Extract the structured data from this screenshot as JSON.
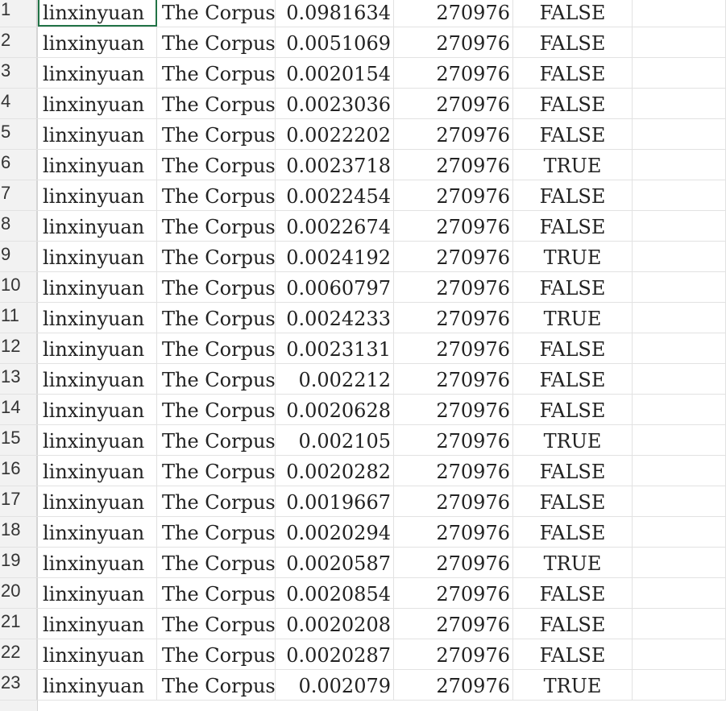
{
  "sheet": {
    "rows": [
      {
        "num": "1",
        "a": "linxinyuan",
        "b": "The Corpus",
        "c": "0.0981634",
        "d": "270976",
        "e": "FALSE"
      },
      {
        "num": "2",
        "a": "linxinyuan",
        "b": "The Corpus",
        "c": "0.0051069",
        "d": "270976",
        "e": "FALSE"
      },
      {
        "num": "3",
        "a": "linxinyuan",
        "b": "The Corpus",
        "c": "0.0020154",
        "d": "270976",
        "e": "FALSE"
      },
      {
        "num": "4",
        "a": "linxinyuan",
        "b": "The Corpus",
        "c": "0.0023036",
        "d": "270976",
        "e": "FALSE"
      },
      {
        "num": "5",
        "a": "linxinyuan",
        "b": "The Corpus",
        "c": "0.0022202",
        "d": "270976",
        "e": "FALSE"
      },
      {
        "num": "6",
        "a": "linxinyuan",
        "b": "The Corpus",
        "c": "0.0023718",
        "d": "270976",
        "e": "TRUE"
      },
      {
        "num": "7",
        "a": "linxinyuan",
        "b": "The Corpus",
        "c": "0.0022454",
        "d": "270976",
        "e": "FALSE"
      },
      {
        "num": "8",
        "a": "linxinyuan",
        "b": "The Corpus",
        "c": "0.0022674",
        "d": "270976",
        "e": "FALSE"
      },
      {
        "num": "9",
        "a": "linxinyuan",
        "b": "The Corpus",
        "c": "0.0024192",
        "d": "270976",
        "e": "TRUE"
      },
      {
        "num": "10",
        "a": "linxinyuan",
        "b": "The Corpus",
        "c": "0.0060797",
        "d": "270976",
        "e": "FALSE"
      },
      {
        "num": "11",
        "a": "linxinyuan",
        "b": "The Corpus",
        "c": "0.0024233",
        "d": "270976",
        "e": "TRUE"
      },
      {
        "num": "12",
        "a": "linxinyuan",
        "b": "The Corpus",
        "c": "0.0023131",
        "d": "270976",
        "e": "FALSE"
      },
      {
        "num": "13",
        "a": "linxinyuan",
        "b": "The Corpus",
        "c": "0.002212",
        "d": "270976",
        "e": "FALSE"
      },
      {
        "num": "14",
        "a": "linxinyuan",
        "b": "The Corpus",
        "c": "0.0020628",
        "d": "270976",
        "e": "FALSE"
      },
      {
        "num": "15",
        "a": "linxinyuan",
        "b": "The Corpus",
        "c": "0.002105",
        "d": "270976",
        "e": "TRUE"
      },
      {
        "num": "16",
        "a": "linxinyuan",
        "b": "The Corpus",
        "c": "0.0020282",
        "d": "270976",
        "e": "FALSE"
      },
      {
        "num": "17",
        "a": "linxinyuan",
        "b": "The Corpus",
        "c": "0.0019667",
        "d": "270976",
        "e": "FALSE"
      },
      {
        "num": "18",
        "a": "linxinyuan",
        "b": "The Corpus",
        "c": "0.0020294",
        "d": "270976",
        "e": "FALSE"
      },
      {
        "num": "19",
        "a": "linxinyuan",
        "b": "The Corpus",
        "c": "0.0020587",
        "d": "270976",
        "e": "TRUE"
      },
      {
        "num": "20",
        "a": "linxinyuan",
        "b": "The Corpus",
        "c": "0.0020854",
        "d": "270976",
        "e": "FALSE"
      },
      {
        "num": "21",
        "a": "linxinyuan",
        "b": "The Corpus",
        "c": "0.0020208",
        "d": "270976",
        "e": "FALSE"
      },
      {
        "num": "22",
        "a": "linxinyuan",
        "b": "The Corpus",
        "c": "0.0020287",
        "d": "270976",
        "e": "FALSE"
      },
      {
        "num": "23",
        "a": "linxinyuan",
        "b": "The Corpus",
        "c": "0.002079",
        "d": "270976",
        "e": "TRUE"
      }
    ]
  }
}
